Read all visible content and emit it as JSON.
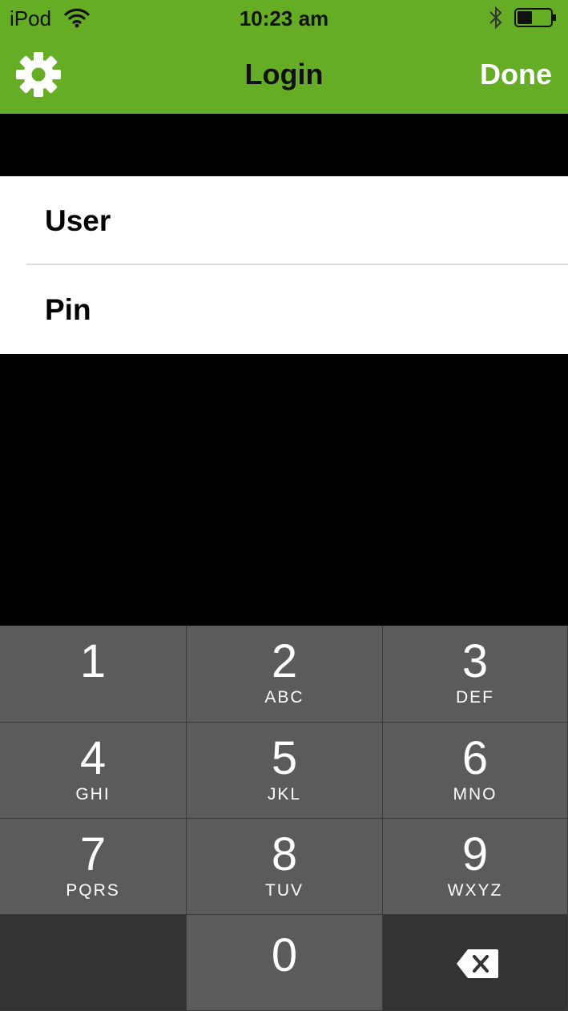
{
  "status_bar": {
    "carrier": "iPod",
    "time": "10:23 am",
    "wifi_icon": "wifi-icon",
    "bluetooth_icon": "bluetooth-icon",
    "battery_icon": "battery-icon",
    "battery_level": 0.45
  },
  "nav": {
    "title": "Login",
    "done_label": "Done",
    "settings_icon": "gear-icon"
  },
  "form": {
    "user_label": "User",
    "pin_label": "Pin"
  },
  "keypad": {
    "keys": [
      {
        "digit": "1",
        "letters": ""
      },
      {
        "digit": "2",
        "letters": "ABC"
      },
      {
        "digit": "3",
        "letters": "DEF"
      },
      {
        "digit": "4",
        "letters": "GHI"
      },
      {
        "digit": "5",
        "letters": "JKL"
      },
      {
        "digit": "6",
        "letters": "MNO"
      },
      {
        "digit": "7",
        "letters": "PQRS"
      },
      {
        "digit": "8",
        "letters": "TUV"
      },
      {
        "digit": "9",
        "letters": "WXYZ"
      },
      {
        "digit": "0",
        "letters": ""
      }
    ],
    "delete_icon": "backspace-icon"
  },
  "colors": {
    "nav_bar": "#66ad26",
    "key": "#5b5b5b",
    "key_dark": "#333333",
    "background": "#000000"
  }
}
